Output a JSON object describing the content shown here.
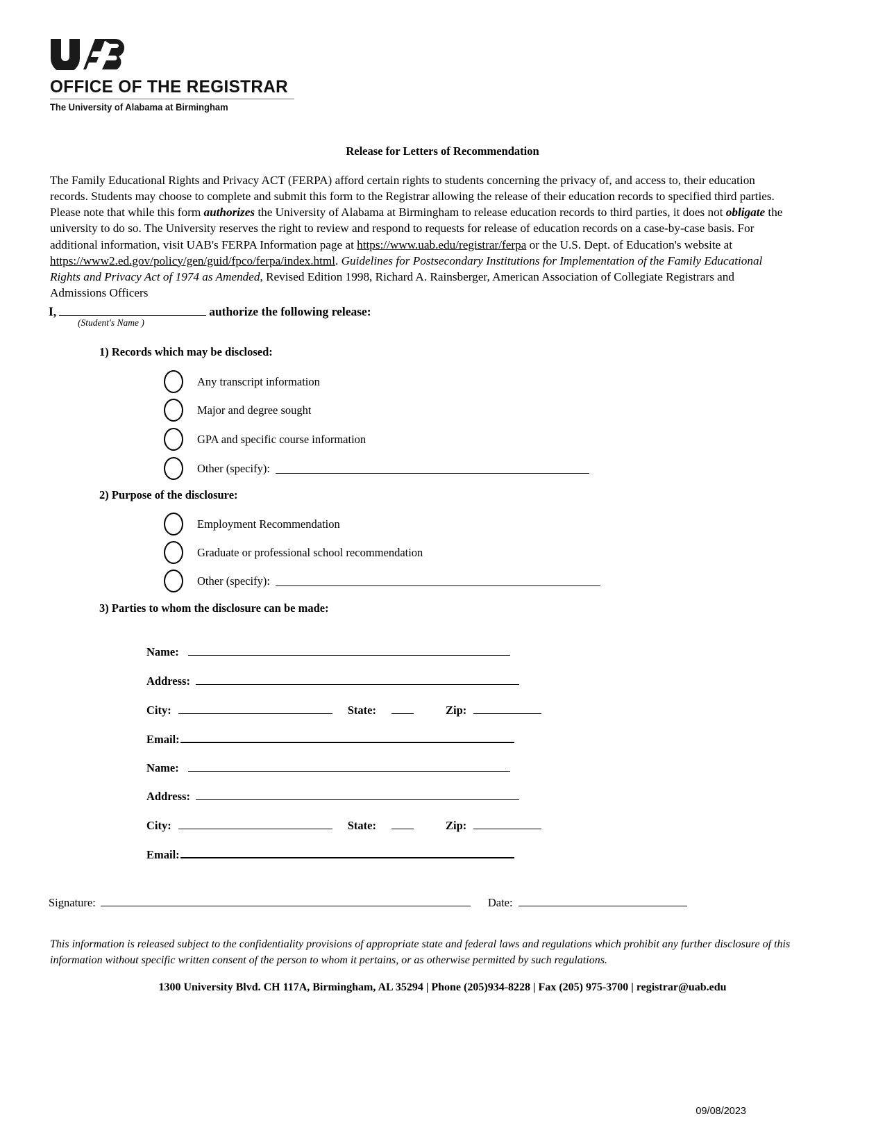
{
  "header": {
    "logo_alt": "UAB",
    "office_title": "OFFICE OF THE REGISTRAR",
    "university": "The University of Alabama at Birmingham"
  },
  "document": {
    "title": "Release for Letters of Recommendation",
    "intro": {
      "p1": "The Family Educational Rights and Privacy ACT (FERPA) afford certain rights to students concerning the privacy of, and access to, their education records. Students may choose to complete and submit this form to the Registrar allowing the release of their education records to specified third parties. Please note that while this form ",
      "bold_italic_1": "authorizes",
      "p2": " the University of Alabama at Birmingham to release education records to third parties, it does not ",
      "bold_italic_2": "obligate",
      "p3": " the university to do so. The University reserves the right to review and respond to requests for release of education records on a case-by-case basis. For additional information, visit UAB's FERPA Information page at ",
      "link1": "https://www.uab.edu/registrar/ferpa",
      "p4": " or the U.S. Dept. of Education's website at ",
      "link2": "https://www2.ed.gov/policy/gen/guid/fpco/ferpa/index.html",
      "p5": ".  ",
      "italic_cite": "Guidelines for Postsecondary Institutions for Implementation of the Family Educational Rights and Privacy Act of 1974 as Amended",
      "p6": ", Revised Edition 1998, Richard A. Rainsberger, American Association of Collegiate Registrars and Admissions Officers"
    }
  },
  "authorize": {
    "prefix": "I,",
    "suffix": "authorize the following release:",
    "caption": "(Student's Name )",
    "name_value": ""
  },
  "section1": {
    "heading": "1) Records which may be disclosed:",
    "options": [
      {
        "label": "Any transcript information",
        "checked": false
      },
      {
        "label": "Major and degree sought",
        "checked": false
      },
      {
        "label": "GPA and specific course information",
        "checked": false
      },
      {
        "label": "Other (specify):",
        "checked": false,
        "specify_value": ""
      }
    ]
  },
  "section2": {
    "heading": "2) Purpose of the disclosure:",
    "options": [
      {
        "label": "Employment Recommendation",
        "checked": false
      },
      {
        "label": "Graduate or professional school recommendation",
        "checked": false
      },
      {
        "label": "Other (specify):",
        "checked": false,
        "specify_value": ""
      }
    ]
  },
  "section3": {
    "heading": "3) Parties to whom the disclosure can be made:",
    "labels": {
      "name": "Name:",
      "address": "Address:",
      "city": "City:",
      "state": "State:",
      "zip": "Zip:",
      "email": "Email:"
    },
    "parties": [
      {
        "name": "",
        "address": "",
        "city": "",
        "state": "",
        "zip": "",
        "email": ""
      },
      {
        "name": "",
        "address": "",
        "city": "",
        "state": "",
        "zip": "",
        "email": ""
      }
    ]
  },
  "signature": {
    "signature_label": "Signature:",
    "signature_value": "",
    "date_label": "Date:",
    "date_value": ""
  },
  "footer": {
    "disclaimer": "This information is released subject to the confidentiality provisions of appropriate state and federal laws and regulations which prohibit any further disclosure of this information without specific written consent of the person to whom it pertains, or as otherwise permitted by such regulations.",
    "contact": "1300 University Blvd. CH 117A, Birmingham, AL 35294 | Phone (205)934-8228 | Fax (205) 975-3700 | registrar@uab.edu",
    "revision_date": "09/08/2023"
  }
}
